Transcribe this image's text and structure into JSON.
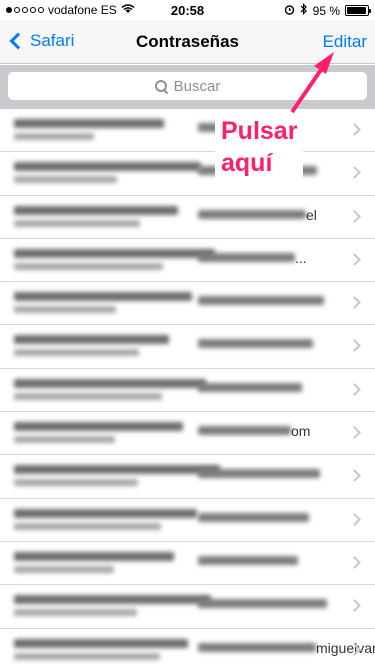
{
  "status_bar": {
    "carrier": "vodafone ES",
    "time": "20:58",
    "battery_text": "95 %",
    "battery_level": 0.95
  },
  "nav": {
    "back_label": "Safari",
    "title": "Contraseñas",
    "edit_label": "Editar"
  },
  "search": {
    "placeholder": "Buscar"
  },
  "list": {
    "rows": [
      {
        "fragment": "a"
      },
      {
        "fragment": ""
      },
      {
        "fragment": "el"
      },
      {
        "fragment": "..."
      },
      {
        "fragment": ""
      },
      {
        "fragment": ""
      },
      {
        "fragment": ""
      },
      {
        "fragment": "om"
      },
      {
        "fragment": ""
      },
      {
        "fragment": ""
      },
      {
        "fragment": ""
      },
      {
        "fragment": ""
      },
      {
        "fragment": "miguelvargas"
      }
    ]
  },
  "annotation": {
    "line1": "Pulsar",
    "line2": "aquí",
    "color": "#ff1f6d"
  },
  "colors": {
    "accent": "#007aff",
    "annotation": "#ff1f6d"
  }
}
